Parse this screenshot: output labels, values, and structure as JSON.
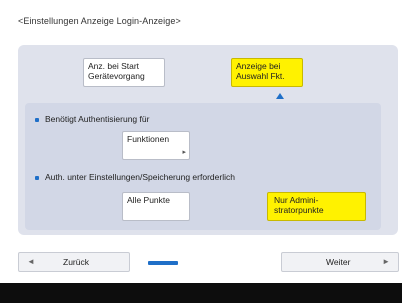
{
  "screen": {
    "title": "<Einstellungen Anzeige Login-Anzeige>"
  },
  "options": {
    "start_label": "Anz. bei Start Gerätevorgang",
    "function_label": "Anzeige bei Auswahl Fkt.",
    "selected": "function_label"
  },
  "section_auth": {
    "label": "Benötigt Authentisierung für",
    "functions_button": "Funktionen"
  },
  "section_settings": {
    "label": "Auth. unter Einstellungen/Speicherung erforderlich",
    "all_items_label": "Alle Punkte",
    "admin_items_label": "Nur Admini-stratorpunkte",
    "selected": "admin_items_label"
  },
  "navigation": {
    "back_label": "Zurück",
    "next_label": "Weiter",
    "progress": 0.25
  },
  "colors": {
    "accent": "#1f6fc8",
    "selected": "#fff200",
    "panel": "#dfe2ec"
  },
  "icons": {
    "back": "left-triangle-icon",
    "next": "right-triangle-icon",
    "submenu": "submenu-arrow-icon"
  }
}
